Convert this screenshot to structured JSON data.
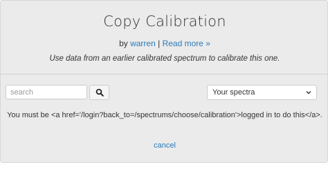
{
  "modal": {
    "title": "Copy Calibration",
    "byline": {
      "prefix": "by ",
      "author": "warren",
      "separator": " | ",
      "read_more": "Read more »"
    },
    "description": "Use data from an earlier calibrated spectrum to calibrate this one.",
    "search": {
      "placeholder": "search",
      "button_icon": "search-icon"
    },
    "spectra_select": {
      "selected": "Your spectra"
    },
    "message": "You must be <a href='/login?back_to=/spectrums/choose/calibration'>logged in to do this</a>.",
    "cancel_label": "cancel"
  },
  "colors": {
    "background": "#ebebeb",
    "link": "#2a7ab8",
    "text": "#333333"
  }
}
